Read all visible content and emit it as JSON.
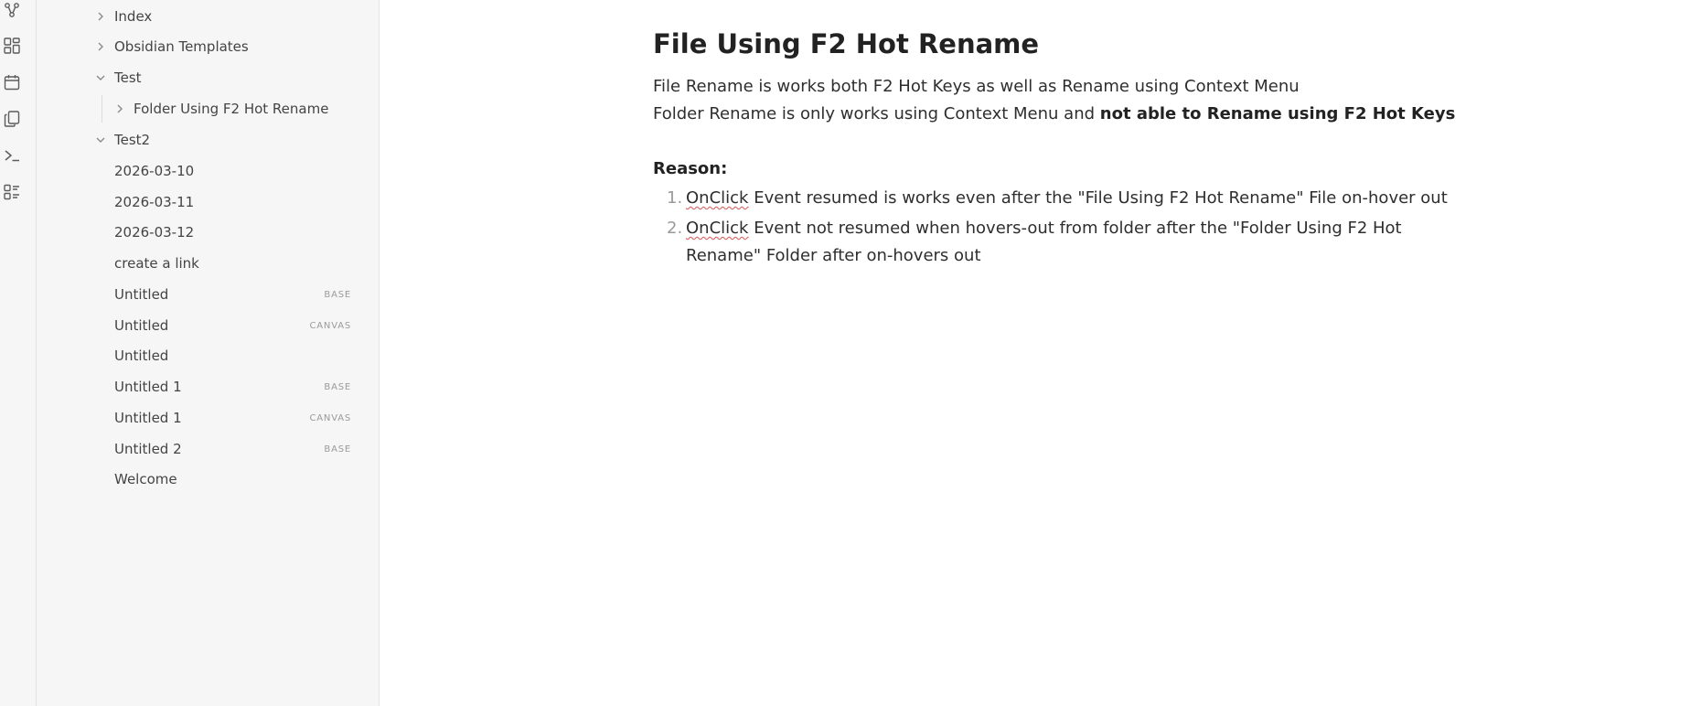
{
  "ribbon": {
    "icons": [
      "graph-view-icon",
      "dashboard-icon",
      "calendar-icon",
      "copy-files-icon",
      "terminal-icon",
      "list-view-icon"
    ]
  },
  "file_explorer": {
    "items": [
      {
        "label": "Index",
        "type": "folder",
        "expanded": false
      },
      {
        "label": "Obsidian Templates",
        "type": "folder",
        "expanded": false
      },
      {
        "label": "Test",
        "type": "folder",
        "expanded": true
      },
      {
        "label": "Folder Using F2 Hot Rename",
        "type": "folder",
        "expanded": false
      },
      {
        "label": "Test2",
        "type": "folder",
        "expanded": true
      },
      {
        "label": "2026-03-10",
        "type": "file",
        "tag": ""
      },
      {
        "label": "2026-03-11",
        "type": "file",
        "tag": ""
      },
      {
        "label": "2026-03-12",
        "type": "file",
        "tag": ""
      },
      {
        "label": "create a link",
        "type": "file",
        "tag": ""
      },
      {
        "label": "Untitled",
        "type": "file",
        "tag": "BASE"
      },
      {
        "label": "Untitled",
        "type": "file",
        "tag": "CANVAS"
      },
      {
        "label": "Untitled",
        "type": "file",
        "tag": ""
      },
      {
        "label": "Untitled 1",
        "type": "file",
        "tag": "BASE"
      },
      {
        "label": "Untitled 1",
        "type": "file",
        "tag": "CANVAS"
      },
      {
        "label": "Untitled 2",
        "type": "file",
        "tag": "BASE"
      },
      {
        "label": "Welcome",
        "type": "file",
        "tag": ""
      }
    ]
  },
  "note": {
    "title": "File Using F2 Hot Rename",
    "line1": "File Rename is works both F2 Hot Keys as well as Rename using Context Menu",
    "line2_plain": "Folder Rename is only works using Context Menu and ",
    "line2_bold": "not able to Rename using F2 Hot Keys",
    "reason_heading": "Reason:",
    "list": [
      {
        "num": "1.",
        "spell": "OnClick",
        "rest": " Event resumed is works even after the \"File Using F2 Hot Rename\" File on-hover out"
      },
      {
        "num": "2.",
        "spell": "OnClick",
        "rest": " Event not resumed when hovers-out from folder after the \"Folder Using F2 Hot Rename\" Folder after on-hovers out"
      }
    ]
  },
  "colors": {
    "sidebar_bg": "#f6f6f6",
    "editor_bg": "#ffffff",
    "text": "#222222",
    "muted": "#9a9a9a",
    "spellcheck": "#e0514f"
  }
}
